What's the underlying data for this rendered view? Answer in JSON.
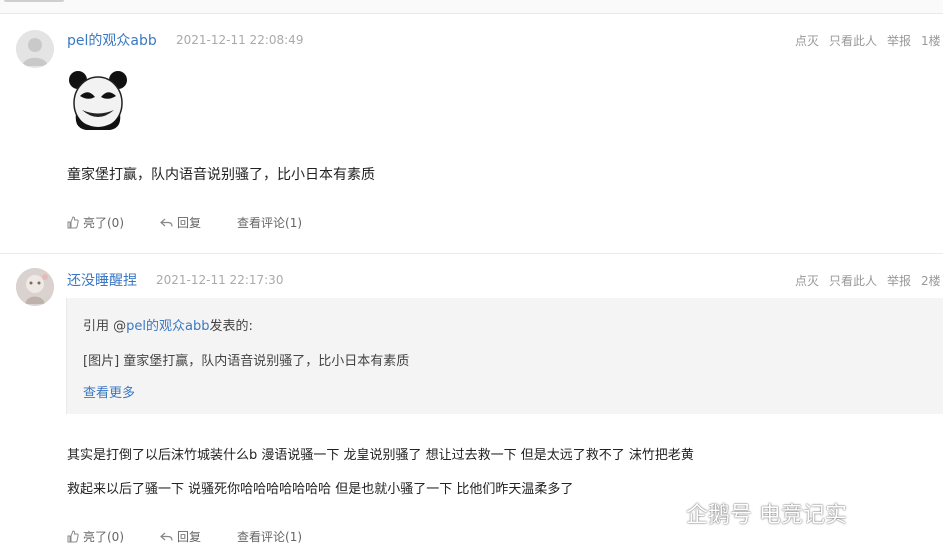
{
  "posts": [
    {
      "username": "pel的观众abb",
      "timestamp": "2021-12-11 22:08:49",
      "actions_right": [
        "点灭",
        "只看此人",
        "举报",
        "1楼"
      ],
      "content": "童家堡打赢，队内语音说别骚了，比小日本有素质",
      "bottom_actions": {
        "like": "亮了(0)",
        "reply": "回复",
        "view_comments": "查看评论(1)"
      },
      "sticker": "panda-meme-sticker"
    },
    {
      "username": "还没睡醒捏",
      "timestamp": "2021-12-11 22:17:30",
      "actions_right": [
        "点灭",
        "只看此人",
        "举报",
        "2楼"
      ],
      "quote": {
        "prefix": "引用 @",
        "quoted_user": "pel的观众abb",
        "suffix": "发表的:",
        "body": "[图片] 童家堡打赢，队内语音说别骚了，比小日本有素质",
        "more": "查看更多"
      },
      "reply_lines": [
        "其实是打倒了以后沫竹城装什么b 漫语说骚一下 龙皇说别骚了 想让过去救一下 但是太远了救不了 沫竹把老黄",
        "救起来以后了骚一下 说骚死你哈哈哈哈哈哈哈 但是也就小骚了一下 比他们昨天温柔多了"
      ],
      "bottom_actions": {
        "like": "亮了(0)",
        "reply": "回复",
        "view_comments": "查看评论(1)"
      }
    }
  ],
  "watermark": {
    "text": "企鹅号 电竞记实",
    "icon": "penguin-logo-icon"
  },
  "colors": {
    "link_blue": "#3b78c2",
    "quote_bg": "#f4f4f4",
    "muted_text": "#999999"
  }
}
